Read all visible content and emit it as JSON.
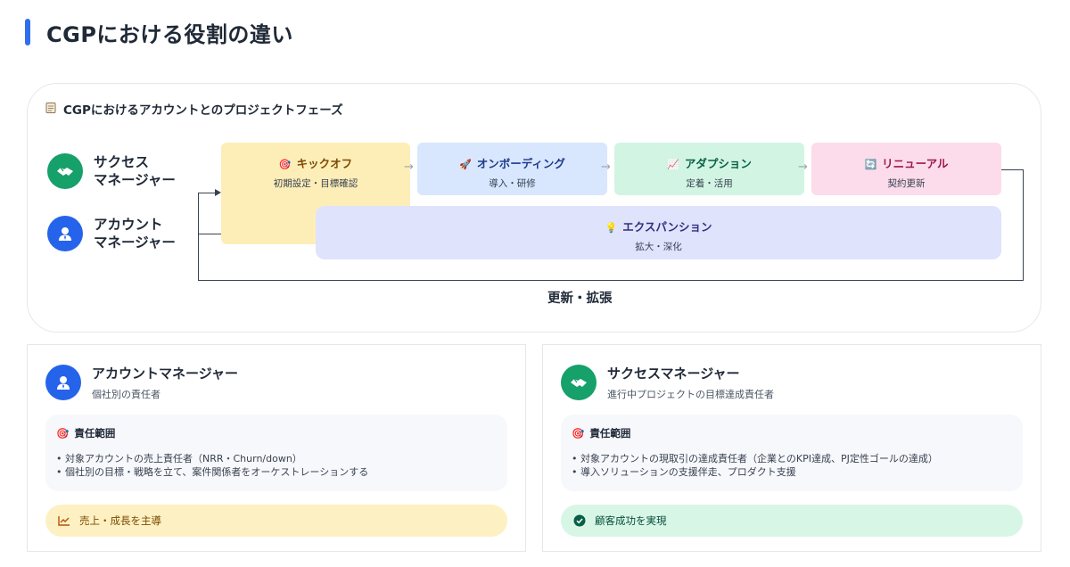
{
  "page": {
    "title": "CGPにおける役割の違い"
  },
  "phase_section": {
    "heading": "CGPにおけるアカウントとのプロジェクトフェーズ",
    "heading_icon": "clipboard-icon",
    "roles": [
      {
        "line1": "サクセス",
        "line2": "マネージャー",
        "icon": "handshake-icon",
        "color": "#16a06a"
      },
      {
        "line1": "アカウント",
        "line2": "マネージャー",
        "icon": "user-icon",
        "color": "#2563eb"
      }
    ],
    "phases": [
      {
        "icon": "🎯",
        "title": "キックオフ",
        "sub": "初期設定・目標確認",
        "bg": "#fdeeb8",
        "color": "#7c4a03"
      },
      {
        "icon": "🚀",
        "title": "オンボーディング",
        "sub": "導入・研修",
        "bg": "#d8e7fd",
        "color": "#1e3a8a"
      },
      {
        "icon": "📈",
        "title": "アダプション",
        "sub": "定着・活用",
        "bg": "#d2f5e3",
        "color": "#065f46"
      },
      {
        "icon": "🔄",
        "title": "リニューアル",
        "sub": "契約更新",
        "bg": "#fcdcea",
        "color": "#9d174d"
      }
    ],
    "expansion": {
      "icon": "💡",
      "title": "エクスパンション",
      "sub": "拡大・深化",
      "bg": "#dfe3fb",
      "color": "#312e81"
    },
    "loop_label": "更新・拡張"
  },
  "cards": [
    {
      "title": "アカウントマネージャー",
      "subtitle": "個社別の責任者",
      "avatar_color": "#2563eb",
      "avatar_icon": "user-icon",
      "scope_icon": "🎯",
      "scope_title": "責任範囲",
      "scope_items": [
        "• 対象アカウントの売上責任者（NRR・Churn/down）",
        "• 個社別の目標・戦略を立て、案件関係者をオーケストレーションする"
      ],
      "result_icon": "chart-line-icon",
      "result_text": "売上・成長を主導",
      "result_bg": "#fdf0c2",
      "result_color": "#7c4a03"
    },
    {
      "title": "サクセスマネージャー",
      "subtitle": "進行中プロジェクトの目標達成責任者",
      "avatar_color": "#16a06a",
      "avatar_icon": "handshake-icon",
      "scope_icon": "🎯",
      "scope_title": "責任範囲",
      "scope_items": [
        "• 対象アカウントの現取引の達成責任者（企業とのKPI達成、PJ定性ゴールの達成）",
        "• 導入ソリューションの支援伴走、プロダクト支援"
      ],
      "result_icon": "check-circle-icon",
      "result_text": "顧客成功を実現",
      "result_bg": "#d8f6e6",
      "result_color": "#064e3b"
    }
  ]
}
